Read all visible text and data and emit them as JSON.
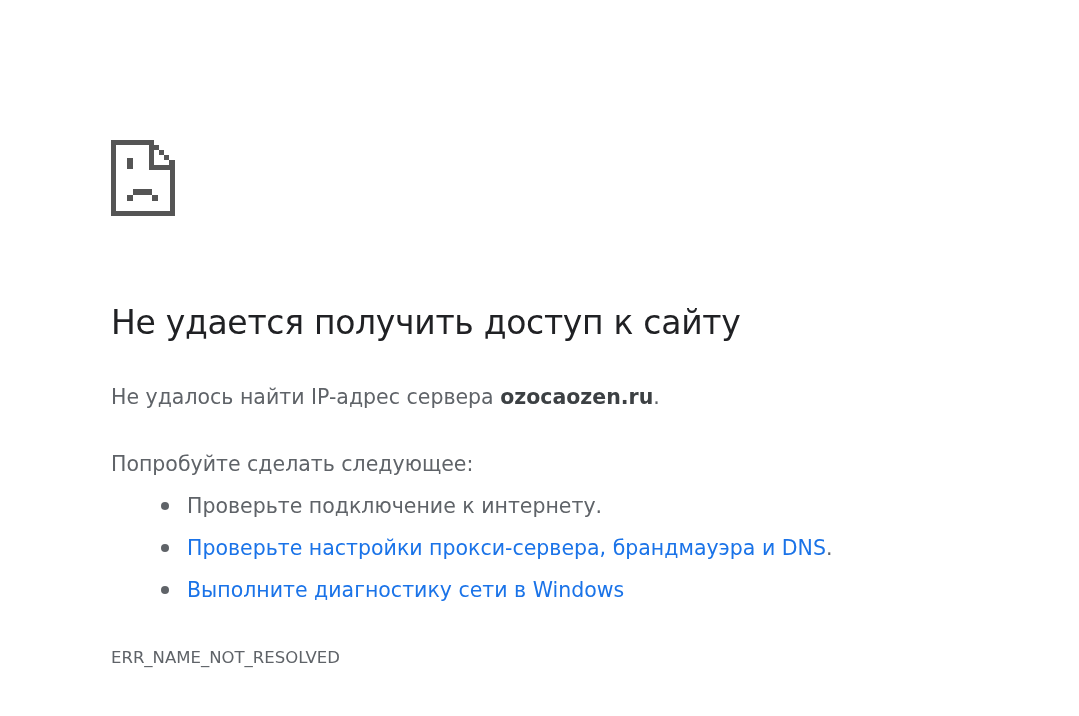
{
  "heading": "Не удается получить доступ к сайту",
  "message": "Не удалось найти IP-адрес сервера **ozocaozen.ru**.",
  "suggestions_title": "Попробуйте сделать следующее:",
  "suggestions": [
    {
      "kind": "text",
      "text": "Проверьте подключение к интернету."
    },
    {
      "kind": "link",
      "text": "Проверьте настройки прокси-сервера, брандмауэра и DNS",
      "suffix": "."
    },
    {
      "kind": "link",
      "text": "Выполните диагностику сети в Windows"
    }
  ],
  "error_code": "ERR_NAME_NOT_RESOLVED"
}
